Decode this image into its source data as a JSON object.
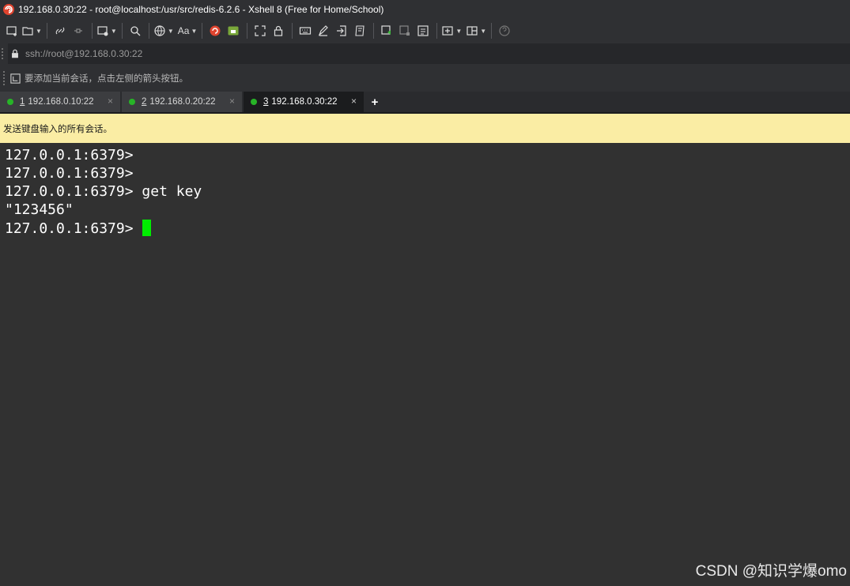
{
  "window": {
    "title": "192.168.0.30:22 - root@localhost:/usr/src/redis-6.2.6 - Xshell 8 (Free for Home/School)",
    "logo_icon": "xshell-logo-icon"
  },
  "toolbar": {
    "items": [
      "new-session-icon",
      "open-session-icon",
      "reconnect-icon",
      "disconnect-icon",
      "new-tab-icon",
      "find-icon",
      "encoding-globe-icon",
      "font-icon",
      "xshell-red-icon",
      "xftp-green-icon",
      "fullscreen-icon",
      "lock-icon",
      "keyboard-icon",
      "highlight-pen-icon",
      "send-file-icon",
      "script-icon",
      "compose-icon",
      "log-icon",
      "notes-icon",
      "new-window-icon",
      "layout-icon",
      "help-icon"
    ],
    "font_label": "Aa"
  },
  "address": {
    "value": "ssh://root@192.168.0.30:22"
  },
  "hint": {
    "text": "要添加当前会话，点击左侧的箭头按钮。"
  },
  "tabs": [
    {
      "number": "1",
      "label": "192.168.0.10:22",
      "active": false
    },
    {
      "number": "2",
      "label": "192.168.0.20:22",
      "active": false
    },
    {
      "number": "3",
      "label": "192.168.0.30:22",
      "active": true
    }
  ],
  "tab_add_label": "+",
  "tab_close_label": "×",
  "broadcast": {
    "text": "发送键盘输入的所有会话。"
  },
  "terminal": {
    "lines": [
      "127.0.0.1:6379>",
      "127.0.0.1:6379>",
      "127.0.0.1:6379> get key",
      "\"123456\"",
      "127.0.0.1:6379> "
    ],
    "cursor_color": "#00ee00"
  },
  "watermark": "CSDN @知识学爆omo",
  "colors": {
    "chrome": "#2f3033",
    "terminal_bg": "#313131",
    "broadcast_bg": "#faeda4",
    "status_green": "#27b427"
  }
}
